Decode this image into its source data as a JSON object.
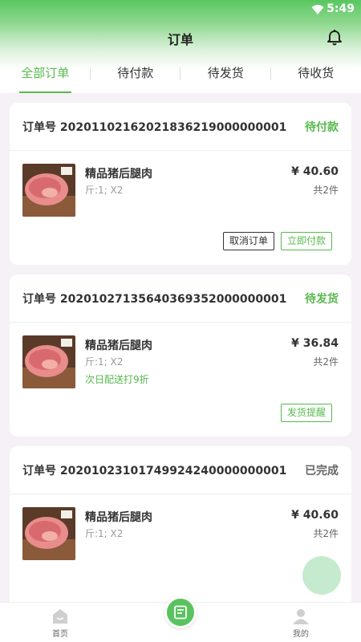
{
  "status_bar": {
    "time": "5:49"
  },
  "header": {
    "title": "订单"
  },
  "tabs": [
    {
      "label": "全部订单",
      "active": true
    },
    {
      "label": "待付款",
      "active": false
    },
    {
      "label": "待发货",
      "active": false
    },
    {
      "label": "待收货",
      "active": false
    }
  ],
  "orders": [
    {
      "order_text": "订单号 20201102162021836219000000001",
      "status": "待付款",
      "product": {
        "name": "精品猪后腿肉",
        "spec": "斤:1; X2",
        "promo": ""
      },
      "price": "¥ 40.60",
      "count": "共2件",
      "buttons": [
        "取消订单",
        "立即付款"
      ]
    },
    {
      "order_text": "订单号 20201027135640369352000000001",
      "status": "待发货",
      "product": {
        "name": "精品猪后腿肉",
        "spec": "斤:1; X2",
        "promo": "次日配送打9折"
      },
      "price": "¥ 36.84",
      "count": "共2件",
      "buttons": [
        "发货提醒"
      ]
    },
    {
      "order_text": "订单号 20201023101749924240000000001",
      "status": "已完成",
      "product": {
        "name": "精品猪后腿肉",
        "spec": "斤:1; X2",
        "promo": ""
      },
      "price": "¥ 40.60",
      "count": "共2件",
      "buttons": []
    }
  ],
  "bottom_nav": {
    "home": "首页",
    "me": "我的"
  },
  "icons": {
    "wifi": "wifi-icon",
    "bell": "bell-icon",
    "home": "home-icon",
    "orders": "order-list-icon",
    "me": "user-icon"
  },
  "colors": {
    "accent": "#57b94d",
    "fab": "#bfe8c9"
  }
}
